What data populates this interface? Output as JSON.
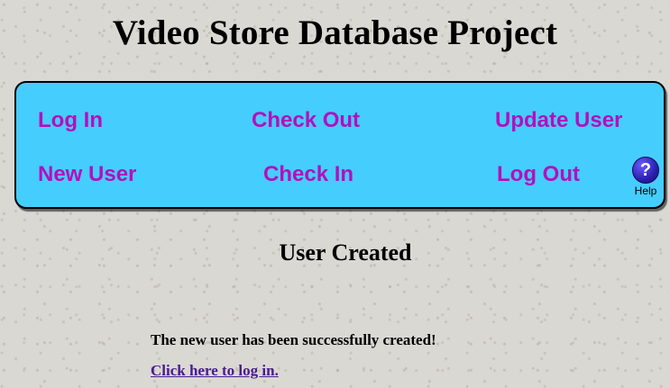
{
  "header": {
    "title": "Video Store Database Project"
  },
  "nav": {
    "log_in": "Log In",
    "check_out": "Check Out",
    "update_user": "Update User",
    "new_user": "New User",
    "check_in": "Check In",
    "log_out": "Log Out",
    "help_icon_glyph": "?",
    "help_label": "Help",
    "panel_color": "#45cdfe",
    "link_color": "#b40fbe"
  },
  "main": {
    "heading": "User Created",
    "message": "The new user has been successfully created!",
    "login_link": "Click here to log in."
  },
  "icons": {
    "help": "help-icon"
  }
}
